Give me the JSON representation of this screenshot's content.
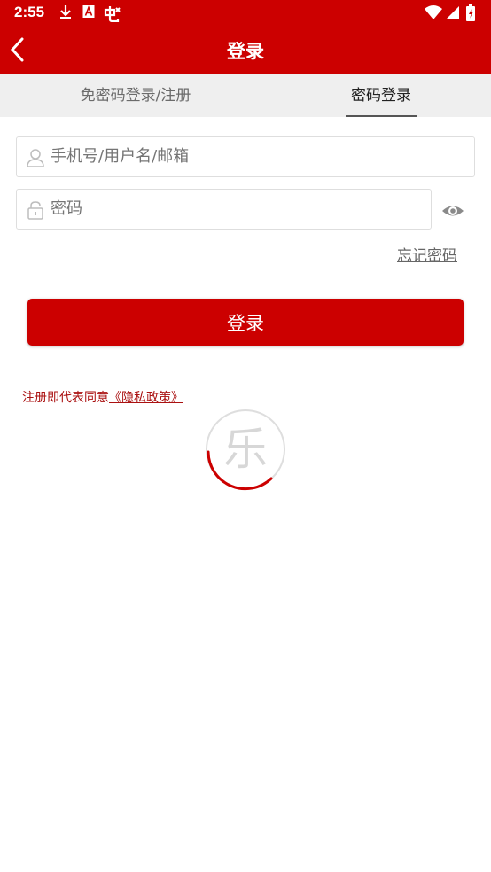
{
  "status_bar": {
    "time": "2:55",
    "icons": [
      "download-icon",
      "a-box-icon",
      "game-icon",
      "wifi-icon",
      "signal-icon",
      "battery-icon"
    ]
  },
  "header": {
    "title": "登录",
    "back_icon": "chevron-left-icon",
    "background": "#cc0000"
  },
  "tabs": [
    {
      "label": "免密码登录/注册",
      "active": false
    },
    {
      "label": "密码登录",
      "active": true
    }
  ],
  "form": {
    "username_placeholder": "手机号/用户名/邮箱",
    "password_placeholder": "密码",
    "forgot_label": "忘记密码",
    "submit_label": "登录"
  },
  "agreement": {
    "prefix": "注册即代表同意",
    "policy_link": "《隐私政策》"
  },
  "loading": {
    "glyph": "乐"
  },
  "colors": {
    "brand": "#cc0000",
    "link": "#aa1111"
  }
}
